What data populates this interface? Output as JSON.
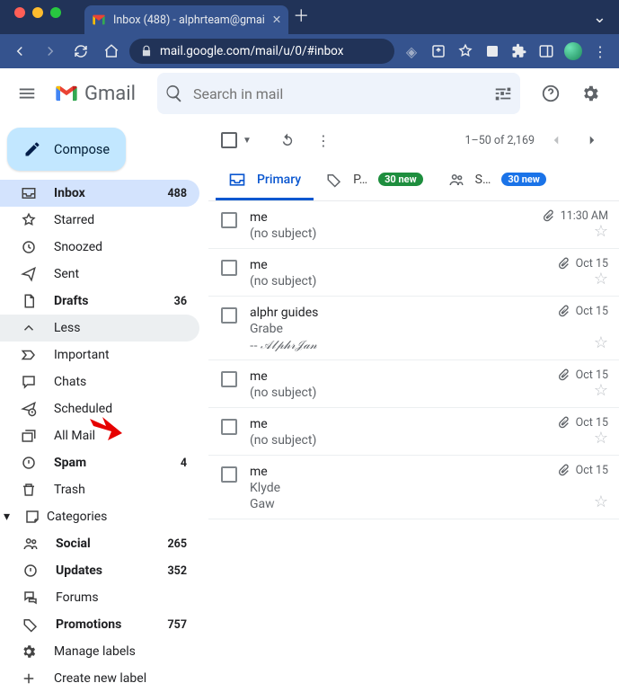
{
  "browser": {
    "tab_title": "Inbox (488) - alphrteam@gmai",
    "url_display": "mail.google.com/mail/u/0/#inbox"
  },
  "header": {
    "app_name": "Gmail",
    "search_placeholder": "Search in mail"
  },
  "compose_label": "Compose",
  "sidebar": {
    "items": [
      {
        "icon": "inbox",
        "label": "Inbox",
        "count": "488",
        "active": true,
        "bold": true
      },
      {
        "icon": "star",
        "label": "Starred"
      },
      {
        "icon": "clock",
        "label": "Snoozed"
      },
      {
        "icon": "send",
        "label": "Sent"
      },
      {
        "icon": "draft",
        "label": "Drafts",
        "count": "36",
        "bold": true
      },
      {
        "icon": "less",
        "label": "Less",
        "hover": true
      },
      {
        "icon": "important",
        "label": "Important"
      },
      {
        "icon": "chats",
        "label": "Chats"
      },
      {
        "icon": "scheduled",
        "label": "Scheduled"
      },
      {
        "icon": "allmail",
        "label": "All Mail"
      },
      {
        "icon": "spam",
        "label": "Spam",
        "count": "4",
        "bold": true
      },
      {
        "icon": "trash",
        "label": "Trash"
      }
    ],
    "categories_label": "Categories",
    "categories": [
      {
        "icon": "social",
        "label": "Social",
        "count": "265",
        "bold": true
      },
      {
        "icon": "updates",
        "label": "Updates",
        "count": "352",
        "bold": true
      },
      {
        "icon": "forums",
        "label": "Forums"
      },
      {
        "icon": "promotions",
        "label": "Promotions",
        "count": "757",
        "bold": true
      }
    ],
    "manage_labels": "Manage labels",
    "create_label": "Create new label"
  },
  "toolbar": {
    "pager_text": "1–50 of 2,169"
  },
  "tabs": [
    {
      "icon": "primary",
      "label": "Primary",
      "active": true
    },
    {
      "icon": "promotions",
      "label": "P…",
      "badge": "30 new",
      "badge_color": "green"
    },
    {
      "icon": "social",
      "label": "S…",
      "badge": "30 new",
      "badge_color": "blue"
    }
  ],
  "emails": [
    {
      "sender": "me",
      "subject": "(no subject)",
      "date": "11:30 AM",
      "attachment": true
    },
    {
      "sender": "me",
      "subject": "(no subject)",
      "date": "Oct 15",
      "attachment": true
    },
    {
      "sender": "alphr guides",
      "subject": "Grabe",
      "signature": "-- 𝒜𝓁𝓅𝒽𝓇𝒥𝒶𝓃",
      "date": "Oct 15",
      "attachment": true
    },
    {
      "sender": "me",
      "subject": "(no subject)",
      "date": "Oct 15",
      "attachment": true
    },
    {
      "sender": "me",
      "subject": "(no subject)",
      "date": "Oct 15",
      "attachment": true
    },
    {
      "sender": "me",
      "subject": "Klyde",
      "snippet": "Gaw",
      "date": "Oct 15",
      "attachment": true
    }
  ]
}
